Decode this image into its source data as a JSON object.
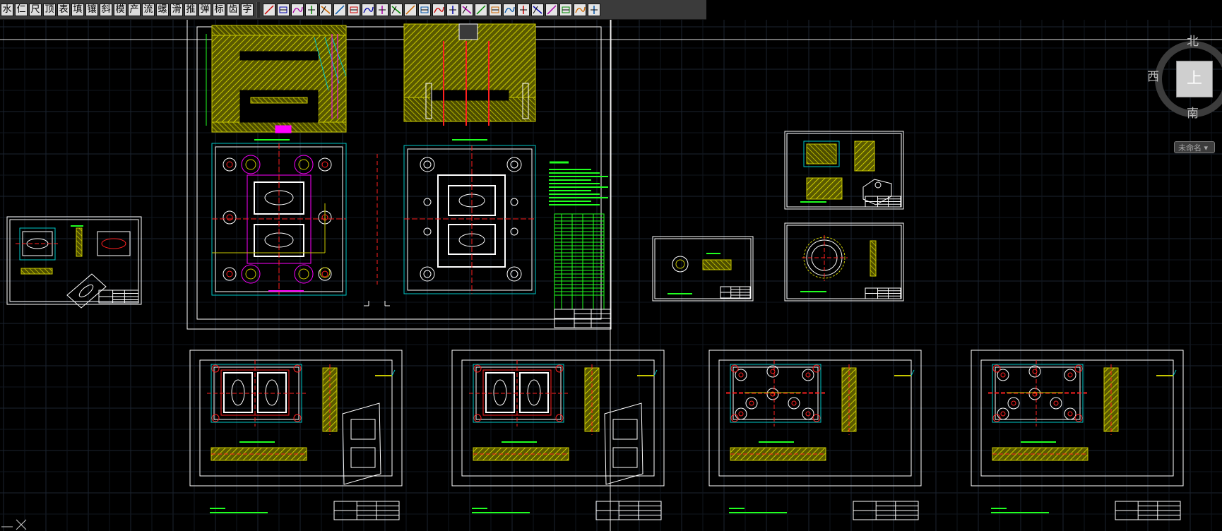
{
  "toolbar": {
    "text_buttons": [
      "水",
      "仁",
      "尺",
      "顶",
      "表",
      "填",
      "镶",
      "斜",
      "模",
      "产",
      "流",
      "螺",
      "滑",
      "推",
      "弹",
      "标",
      "齿",
      "字"
    ],
    "icon_buttons": [
      "grid-icon",
      "insert-icon",
      "line-icon",
      "measure-icon",
      "chart-icon",
      "curve-icon",
      "wave-icon",
      "stack-icon",
      "layers-icon",
      "hatch-icon",
      "triangle-icon",
      "angle-icon",
      "diagonal-icon",
      "slash-icon",
      "line-tool-icon",
      "bracket-icon",
      "point-icon",
      "arc-icon",
      "break-icon",
      "box-icon",
      "tee-icon",
      "dim-icon",
      "vdim-icon",
      "panel-icon"
    ]
  },
  "viewcube": {
    "north": "北",
    "west": "西",
    "south": "南",
    "top": "上",
    "wcs": "未命名 ▾"
  },
  "colors": {
    "background": "#000000",
    "grid": "#1b2430",
    "frame": "#ffffff",
    "mold_plate": "#c8c800",
    "centerline": "#ff2020",
    "dimension": "#00c8c8",
    "note": "#20ff20",
    "part": "#ff00ff"
  }
}
